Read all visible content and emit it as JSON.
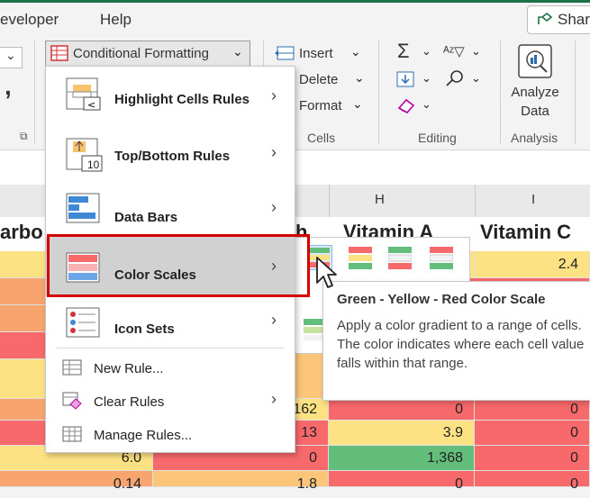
{
  "tabs": {
    "developer": "eveloper",
    "help": "Help",
    "share": "Shar"
  },
  "ribbon": {
    "conditional_formatting": "Conditional Formatting",
    "insert": "Insert",
    "delete": "Delete",
    "format": "Format",
    "cells_group": "Cells",
    "editing_group": "Editing",
    "analyze_line1": "Analyze",
    "analyze_line2": "Data",
    "analysis_group": "Analysis"
  },
  "menu": {
    "items": [
      {
        "label": "Highlight Cells Rules"
      },
      {
        "label": "Top/Bottom Rules"
      },
      {
        "label": "Data Bars"
      },
      {
        "label": "Color Scales"
      },
      {
        "label": "Icon Sets"
      },
      {
        "label": "New Rule..."
      },
      {
        "label": "Clear Rules"
      },
      {
        "label": "Manage Rules..."
      }
    ],
    "icon_top_bottom_number": "10"
  },
  "tooltip": {
    "title": "Green - Yellow - Red Color Scale",
    "body": "Apply a color gradient to a range of cells. The color indicates where each cell value falls within that range."
  },
  "sheet": {
    "col_h": "H",
    "col_i": "I",
    "header_left": "arbo",
    "header_h": "Vitamin A",
    "header_i": "Vitamin C",
    "header_g_partial": "h",
    "rows": [
      {
        "f": "",
        "g": "",
        "h": "",
        "i": "2.4"
      },
      {
        "f": "",
        "g": "162",
        "h": "0",
        "i": "0"
      },
      {
        "f": "",
        "g": "13",
        "h": "3.9",
        "i": "0"
      },
      {
        "f": "6.0",
        "g": "0",
        "h": "1,368",
        "i": "0"
      },
      {
        "f": "0.14",
        "g": "1.8",
        "h": "0",
        "i": "0"
      }
    ]
  },
  "colors": {
    "red": "#f8696b",
    "orange": "#f8a46f",
    "yellow": "#fde283",
    "green": "#63be7b",
    "light_orange": "#fbc67a",
    "accent_green": "#1e7145"
  }
}
